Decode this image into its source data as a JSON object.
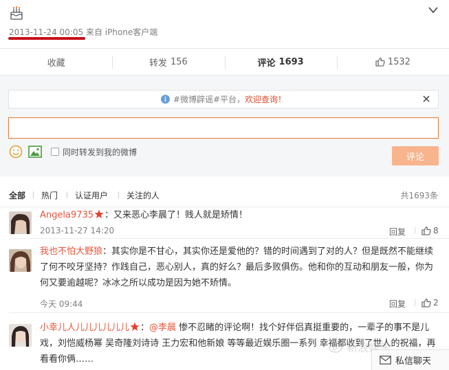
{
  "post": {
    "meta_line": "2013-11-24 00:05 来自 iPhone客户端",
    "actions": [
      {
        "label": "收藏",
        "count": ""
      },
      {
        "label": "转发",
        "count": "156"
      },
      {
        "label": "评论",
        "count": "1693"
      },
      {
        "label": "",
        "count": "1532"
      }
    ]
  },
  "comment_box": {
    "notice_prefix": "#微博辟谣#平台，",
    "notice_highlight": "欢迎查询！",
    "input_value": "",
    "repost_label": "同时转发到我的微博",
    "submit_label": "评论"
  },
  "filters": {
    "items": [
      "全部",
      "热门",
      "认证用户",
      "关注的人"
    ],
    "total": "共1693条"
  },
  "comments": [
    {
      "user": "Angela9735",
      "text": "：又来恶心李晨了！贱人就是矫情！",
      "time": "2013-11-27 14:20",
      "reply": "回复",
      "likes": "8"
    },
    {
      "user": "我也不怕大野狼",
      "text": "：其实你是不甘心，其实你还是爱他的？错的时间遇到了对的人？但是既然不能继续了何不咬牙坚持？作践自己，恶心别人，真的好么？最后多败俱伤。他和你的互动和朋友一般，你为何又要逾越呢？冰冰之所以成功是因为她不矫情。",
      "time": "今天 09:44",
      "reply": "回复",
      "likes": "2"
    },
    {
      "user": "小幸儿人儿儿儿儿儿儿",
      "mention": "@李晨",
      "text": " 惨不忍睹的评论啊！找个好伴侣真挺重要的，一辈子的事不是儿戏，刘恺威杨幂 吴奇隆刘诗诗 王力宏和他新娘 等等最近娱乐圈一系列 幸福都收到了世人的祝福，再看看你俩……",
      "time": "",
      "reply": "",
      "likes": ""
    }
  ],
  "overlay": {
    "watermark": "新浪娱乐",
    "dm_label": "私信聊天"
  }
}
